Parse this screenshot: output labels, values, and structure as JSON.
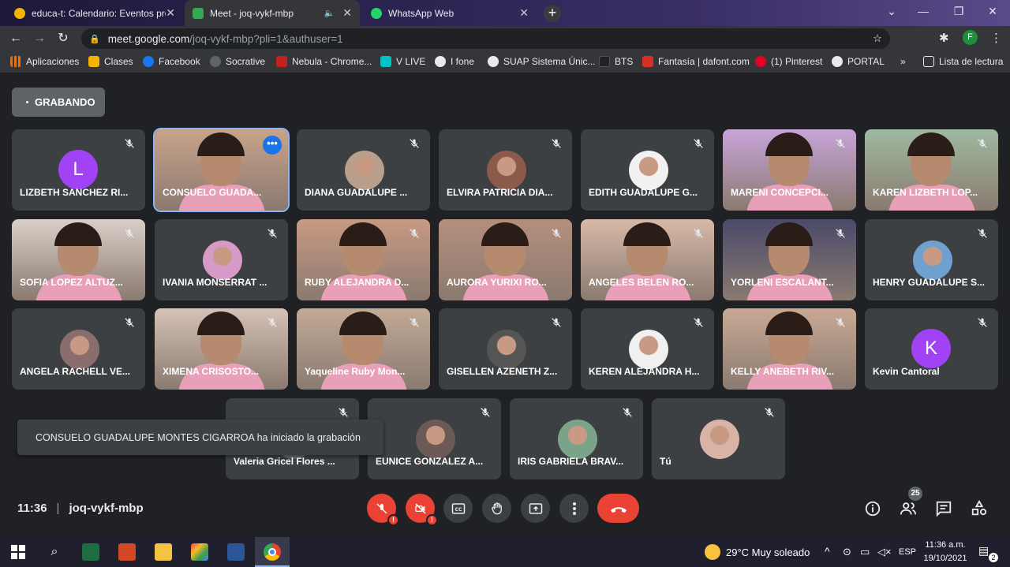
{
  "tabs": [
    {
      "title": "educa-t: Calendario: Eventos próx",
      "color": "#f4b400"
    },
    {
      "title": "Meet - joq-vykf-mbp",
      "color": "#34a853"
    },
    {
      "title": "WhatsApp Web",
      "color": "#25d366"
    }
  ],
  "address": {
    "host": "meet.google.com",
    "path": "/joq-vykf-mbp?pli=1&authuser=1"
  },
  "profile_letter": "F",
  "bookmarks": [
    {
      "label": "Aplicaciones",
      "color": "#e8710a"
    },
    {
      "label": "Clases",
      "color": "#f4b400"
    },
    {
      "label": "Facebook",
      "color": "#1877f2"
    },
    {
      "label": "Socrative",
      "color": "#5f6368"
    },
    {
      "label": "Nebula - Chrome...",
      "color": "#c5221f"
    },
    {
      "label": "V LIVE",
      "color": "#00c2c7"
    },
    {
      "label": "I fone",
      "color": "#e8eaed"
    },
    {
      "label": "SUAP Sistema Únic...",
      "color": "#e8eaed"
    },
    {
      "label": "BTS",
      "color": "#202124"
    },
    {
      "label": "Fantasía | dafont.com",
      "color": "#d93025"
    },
    {
      "label": "(1) Pinterest",
      "color": "#e60023"
    },
    {
      "label": "PORTAL",
      "color": "#e8eaed"
    }
  ],
  "bookmarks_more": "»",
  "reading_list": "Lista de lectura",
  "recording_label": "GRABANDO",
  "participants": [
    {
      "name": "LIZBETH SANCHEZ RI...",
      "type": "letter",
      "letter": "L",
      "color": "#a142f4"
    },
    {
      "name": "CONSUELO GUADA...",
      "type": "video",
      "color": "#c9a38b",
      "active": true
    },
    {
      "name": "DIANA GUADALUPE ...",
      "type": "avatar",
      "color": "#b9a08c"
    },
    {
      "name": "ELVIRA PATRICIA DIA...",
      "type": "avatar",
      "color": "#8c5a4a"
    },
    {
      "name": "EDITH GUADALUPE G...",
      "type": "avatar",
      "color": "#f1f1f1"
    },
    {
      "name": "MARENI CONCEPCI...",
      "type": "video",
      "color": "#c7a4d8"
    },
    {
      "name": "KAREN LIZBETH LOP...",
      "type": "video",
      "color": "#9fb9a0"
    },
    {
      "name": "SOFIA LOPEZ ALTUZ...",
      "type": "video",
      "color": "#d9cfc8"
    },
    {
      "name": "IVANIA MONSERRAT ...",
      "type": "avatar",
      "color": "#d59ac6"
    },
    {
      "name": "RUBY ALEJANDRA D...",
      "type": "video",
      "color": "#c89a84"
    },
    {
      "name": "AURORA YURIXI RO...",
      "type": "video",
      "color": "#b58f7c"
    },
    {
      "name": "ANGELES BELEN RO...",
      "type": "video",
      "color": "#d7b9a8"
    },
    {
      "name": "YORLENI ESCALANT...",
      "type": "video",
      "color": "#4a4a6a"
    },
    {
      "name": "HENRY GUADALUPE S...",
      "type": "avatar",
      "color": "#6fa0d0"
    },
    {
      "name": "ANGELA RACHELL VE...",
      "type": "avatar",
      "color": "#8a6e6e"
    },
    {
      "name": "XIMENA CRISOSTO...",
      "type": "video",
      "color": "#d6c2b6"
    },
    {
      "name": "Yaqueline Ruby Mon...",
      "type": "video",
      "color": "#c2aa96"
    },
    {
      "name": "GISELLEN AZENETH Z...",
      "type": "avatar",
      "color": "#555555"
    },
    {
      "name": "KEREN ALEJANDRA H...",
      "type": "avatar",
      "color": "#f0f0f0"
    },
    {
      "name": "KELLY ANEBETH RIV...",
      "type": "video",
      "color": "#c9a994"
    },
    {
      "name": "Kevin Cantoral",
      "type": "letter",
      "letter": "K",
      "color": "#a142f4"
    },
    {
      "name": "Valeria Gricel Flores ...",
      "type": "avatar",
      "color": "#6b6e72"
    },
    {
      "name": "EUNICE GONZALEZ A...",
      "type": "avatar",
      "color": "#6b5a55"
    },
    {
      "name": "IRIS GABRIELA BRAV...",
      "type": "avatar",
      "color": "#7aa38a"
    },
    {
      "name": "Tú",
      "type": "avatar",
      "color": "#d9b3a6"
    }
  ],
  "toast": "CONSUELO GUADALUPE MONTES CIGARROA ha iniciado la grabación",
  "meeting": {
    "time": "11:36",
    "sep": "|",
    "code": "joq-vykf-mbp"
  },
  "participant_count": "25",
  "warn_mark": "!",
  "taskbar": {
    "weather": "29°C  Muy soleado",
    "lang": "ESP",
    "time": "11:36 a.m.",
    "date": "19/10/2021",
    "notif": "2"
  }
}
